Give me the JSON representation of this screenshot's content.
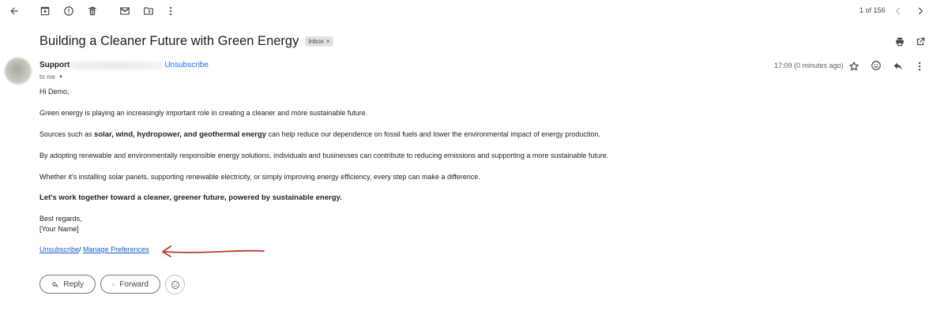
{
  "toolbar": {
    "icons": [
      "back-arrow-icon",
      "archive-icon",
      "report-spam-icon",
      "delete-icon",
      "mark-unread-icon",
      "move-to-icon",
      "more-vert-icon"
    ],
    "pager": "1 of 156"
  },
  "email": {
    "subject": "Building a Cleaner Future with Green Energy",
    "label": "Inbox",
    "label_close": "×",
    "sender_name": "Support",
    "sender_separator": "<",
    "sender_unsubscribe": "Unsubscribe",
    "recipient": "to me",
    "timestamp": "17:09 (0 minutes ago)",
    "body": {
      "greeting": "Hi Demo,",
      "p1": "Green energy is playing an increasingly important role in creating a cleaner and more sustainable future.",
      "p2_before": "Sources such as ",
      "p2_bold": "solar, wind, hydropower, and geothermal energy",
      "p2_after": " can help reduce our dependence on fossil fuels and lower the environmental impact of energy production.",
      "p3": "By adopting renewable and environmentally responsible energy solutions, individuals and businesses can contribute to reducing emissions and supporting a more sustainable future.",
      "p4": "Whether it's installing solar panels, supporting renewable electricity, or simply improving energy efficiency, every step can make a difference.",
      "p5": "Let's work together toward a cleaner, greener future, powered by sustainable energy.",
      "closing": "Best regards,",
      "signature": "[Your Name]"
    },
    "footer_links": {
      "unsubscribe": "Unsubscribe",
      "separator": "/ ",
      "manage": "Manage Preferences"
    }
  },
  "actions": {
    "reply": "Reply",
    "forward": "Forward"
  },
  "colors": {
    "link": "#1a73e8",
    "arrow": "#c0392b"
  }
}
